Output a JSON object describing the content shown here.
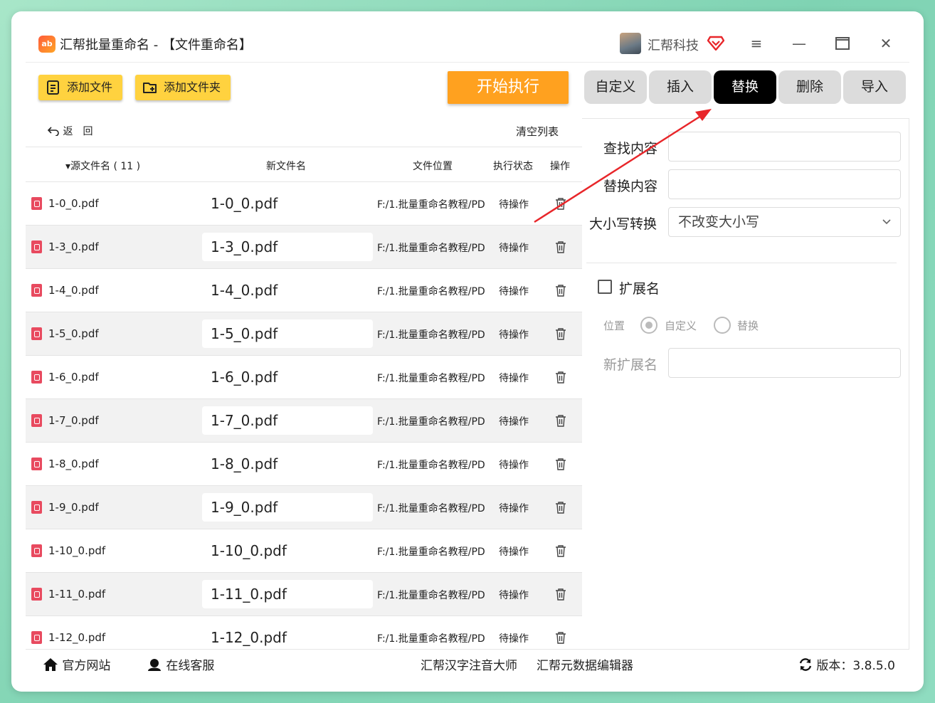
{
  "window": {
    "app_logo_text": "ab",
    "title": "汇帮批量重命名 - 【文件重命名】",
    "user_name": "汇帮科技",
    "controls": {
      "menu": "≡",
      "minimize": "—",
      "maximize": "□",
      "close": "✕"
    }
  },
  "toolbar": {
    "add_file": "添加文件",
    "add_folder": "添加文件夹",
    "start": "开始执行"
  },
  "tabs": [
    {
      "label": "自定义",
      "active": false
    },
    {
      "label": "插入",
      "active": false
    },
    {
      "label": "替换",
      "active": true
    },
    {
      "label": "删除",
      "active": false
    },
    {
      "label": "导入",
      "active": false
    }
  ],
  "list": {
    "back_label": "返　回",
    "clear_label": "清空列表",
    "headers": {
      "source": "源文件名 ( 11 )",
      "new_name": "新文件名",
      "location": "文件位置",
      "status": "执行状态",
      "action": "操作"
    },
    "rows": [
      {
        "source": "1-0_0.pdf",
        "new_name": "1-0_0.pdf",
        "location": "F:/1.批量重命名教程/PD",
        "status": "待操作"
      },
      {
        "source": "1-3_0.pdf",
        "new_name": "1-3_0.pdf",
        "location": "F:/1.批量重命名教程/PD",
        "status": "待操作"
      },
      {
        "source": "1-4_0.pdf",
        "new_name": "1-4_0.pdf",
        "location": "F:/1.批量重命名教程/PD",
        "status": "待操作"
      },
      {
        "source": "1-5_0.pdf",
        "new_name": "1-5_0.pdf",
        "location": "F:/1.批量重命名教程/PD",
        "status": "待操作"
      },
      {
        "source": "1-6_0.pdf",
        "new_name": "1-6_0.pdf",
        "location": "F:/1.批量重命名教程/PD",
        "status": "待操作"
      },
      {
        "source": "1-7_0.pdf",
        "new_name": "1-7_0.pdf",
        "location": "F:/1.批量重命名教程/PD",
        "status": "待操作"
      },
      {
        "source": "1-8_0.pdf",
        "new_name": "1-8_0.pdf",
        "location": "F:/1.批量重命名教程/PD",
        "status": "待操作"
      },
      {
        "source": "1-9_0.pdf",
        "new_name": "1-9_0.pdf",
        "location": "F:/1.批量重命名教程/PD",
        "status": "待操作"
      },
      {
        "source": "1-10_0.pdf",
        "new_name": "1-10_0.pdf",
        "location": "F:/1.批量重命名教程/PD",
        "status": "待操作"
      },
      {
        "source": "1-11_0.pdf",
        "new_name": "1-11_0.pdf",
        "location": "F:/1.批量重命名教程/PD",
        "status": "待操作"
      },
      {
        "source": "1-12_0.pdf",
        "new_name": "1-12_0.pdf",
        "location": "F:/1.批量重命名教程/PD",
        "status": "待操作"
      }
    ]
  },
  "settings": {
    "find_label": "查找内容",
    "find_value": "",
    "replace_label": "替换内容",
    "replace_value": "",
    "case_label": "大小写转换",
    "case_value": "不改变大小写",
    "ext_label": "扩展名",
    "ext_checked": false,
    "position_label": "位置",
    "radio_custom": "自定义",
    "radio_replace": "替换",
    "new_ext_label": "新扩展名",
    "new_ext_value": ""
  },
  "statusbar": {
    "official_site": "官方网站",
    "online_service": "在线客服",
    "link1": "汇帮汉字注音大师",
    "link2": "汇帮元数据编辑器",
    "version": "版本：3.8.5.0"
  },
  "colors": {
    "accent_yellow": "#ffd23f",
    "start_orange": "#ffa11f",
    "active_tab": "#000000",
    "annotation_arrow": "#e8262a",
    "pdf_icon": "#e84a5f"
  }
}
